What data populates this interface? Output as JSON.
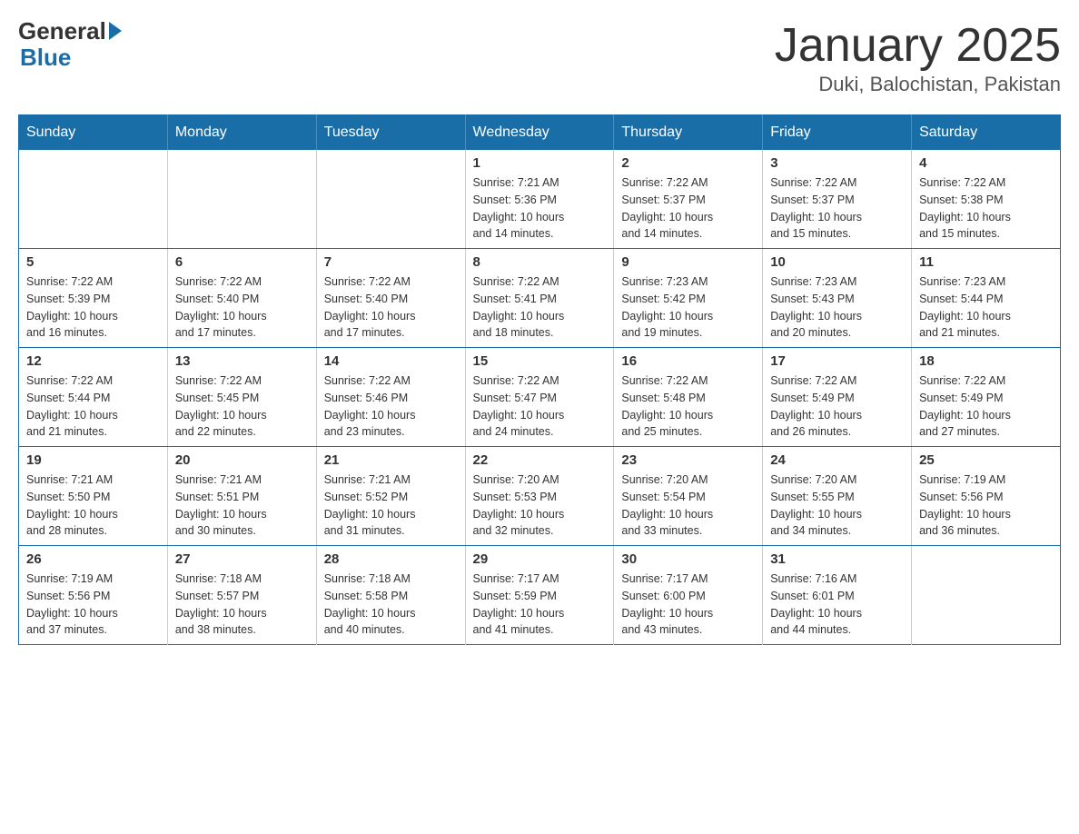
{
  "header": {
    "logo_general": "General",
    "logo_blue": "Blue",
    "month_title": "January 2025",
    "location": "Duki, Balochistan, Pakistan"
  },
  "calendar": {
    "days_of_week": [
      "Sunday",
      "Monday",
      "Tuesday",
      "Wednesday",
      "Thursday",
      "Friday",
      "Saturday"
    ],
    "weeks": [
      [
        {
          "day": "",
          "info": ""
        },
        {
          "day": "",
          "info": ""
        },
        {
          "day": "",
          "info": ""
        },
        {
          "day": "1",
          "info": "Sunrise: 7:21 AM\nSunset: 5:36 PM\nDaylight: 10 hours\nand 14 minutes."
        },
        {
          "day": "2",
          "info": "Sunrise: 7:22 AM\nSunset: 5:37 PM\nDaylight: 10 hours\nand 14 minutes."
        },
        {
          "day": "3",
          "info": "Sunrise: 7:22 AM\nSunset: 5:37 PM\nDaylight: 10 hours\nand 15 minutes."
        },
        {
          "day": "4",
          "info": "Sunrise: 7:22 AM\nSunset: 5:38 PM\nDaylight: 10 hours\nand 15 minutes."
        }
      ],
      [
        {
          "day": "5",
          "info": "Sunrise: 7:22 AM\nSunset: 5:39 PM\nDaylight: 10 hours\nand 16 minutes."
        },
        {
          "day": "6",
          "info": "Sunrise: 7:22 AM\nSunset: 5:40 PM\nDaylight: 10 hours\nand 17 minutes."
        },
        {
          "day": "7",
          "info": "Sunrise: 7:22 AM\nSunset: 5:40 PM\nDaylight: 10 hours\nand 17 minutes."
        },
        {
          "day": "8",
          "info": "Sunrise: 7:22 AM\nSunset: 5:41 PM\nDaylight: 10 hours\nand 18 minutes."
        },
        {
          "day": "9",
          "info": "Sunrise: 7:23 AM\nSunset: 5:42 PM\nDaylight: 10 hours\nand 19 minutes."
        },
        {
          "day": "10",
          "info": "Sunrise: 7:23 AM\nSunset: 5:43 PM\nDaylight: 10 hours\nand 20 minutes."
        },
        {
          "day": "11",
          "info": "Sunrise: 7:23 AM\nSunset: 5:44 PM\nDaylight: 10 hours\nand 21 minutes."
        }
      ],
      [
        {
          "day": "12",
          "info": "Sunrise: 7:22 AM\nSunset: 5:44 PM\nDaylight: 10 hours\nand 21 minutes."
        },
        {
          "day": "13",
          "info": "Sunrise: 7:22 AM\nSunset: 5:45 PM\nDaylight: 10 hours\nand 22 minutes."
        },
        {
          "day": "14",
          "info": "Sunrise: 7:22 AM\nSunset: 5:46 PM\nDaylight: 10 hours\nand 23 minutes."
        },
        {
          "day": "15",
          "info": "Sunrise: 7:22 AM\nSunset: 5:47 PM\nDaylight: 10 hours\nand 24 minutes."
        },
        {
          "day": "16",
          "info": "Sunrise: 7:22 AM\nSunset: 5:48 PM\nDaylight: 10 hours\nand 25 minutes."
        },
        {
          "day": "17",
          "info": "Sunrise: 7:22 AM\nSunset: 5:49 PM\nDaylight: 10 hours\nand 26 minutes."
        },
        {
          "day": "18",
          "info": "Sunrise: 7:22 AM\nSunset: 5:49 PM\nDaylight: 10 hours\nand 27 minutes."
        }
      ],
      [
        {
          "day": "19",
          "info": "Sunrise: 7:21 AM\nSunset: 5:50 PM\nDaylight: 10 hours\nand 28 minutes."
        },
        {
          "day": "20",
          "info": "Sunrise: 7:21 AM\nSunset: 5:51 PM\nDaylight: 10 hours\nand 30 minutes."
        },
        {
          "day": "21",
          "info": "Sunrise: 7:21 AM\nSunset: 5:52 PM\nDaylight: 10 hours\nand 31 minutes."
        },
        {
          "day": "22",
          "info": "Sunrise: 7:20 AM\nSunset: 5:53 PM\nDaylight: 10 hours\nand 32 minutes."
        },
        {
          "day": "23",
          "info": "Sunrise: 7:20 AM\nSunset: 5:54 PM\nDaylight: 10 hours\nand 33 minutes."
        },
        {
          "day": "24",
          "info": "Sunrise: 7:20 AM\nSunset: 5:55 PM\nDaylight: 10 hours\nand 34 minutes."
        },
        {
          "day": "25",
          "info": "Sunrise: 7:19 AM\nSunset: 5:56 PM\nDaylight: 10 hours\nand 36 minutes."
        }
      ],
      [
        {
          "day": "26",
          "info": "Sunrise: 7:19 AM\nSunset: 5:56 PM\nDaylight: 10 hours\nand 37 minutes."
        },
        {
          "day": "27",
          "info": "Sunrise: 7:18 AM\nSunset: 5:57 PM\nDaylight: 10 hours\nand 38 minutes."
        },
        {
          "day": "28",
          "info": "Sunrise: 7:18 AM\nSunset: 5:58 PM\nDaylight: 10 hours\nand 40 minutes."
        },
        {
          "day": "29",
          "info": "Sunrise: 7:17 AM\nSunset: 5:59 PM\nDaylight: 10 hours\nand 41 minutes."
        },
        {
          "day": "30",
          "info": "Sunrise: 7:17 AM\nSunset: 6:00 PM\nDaylight: 10 hours\nand 43 minutes."
        },
        {
          "day": "31",
          "info": "Sunrise: 7:16 AM\nSunset: 6:01 PM\nDaylight: 10 hours\nand 44 minutes."
        },
        {
          "day": "",
          "info": ""
        }
      ]
    ]
  }
}
